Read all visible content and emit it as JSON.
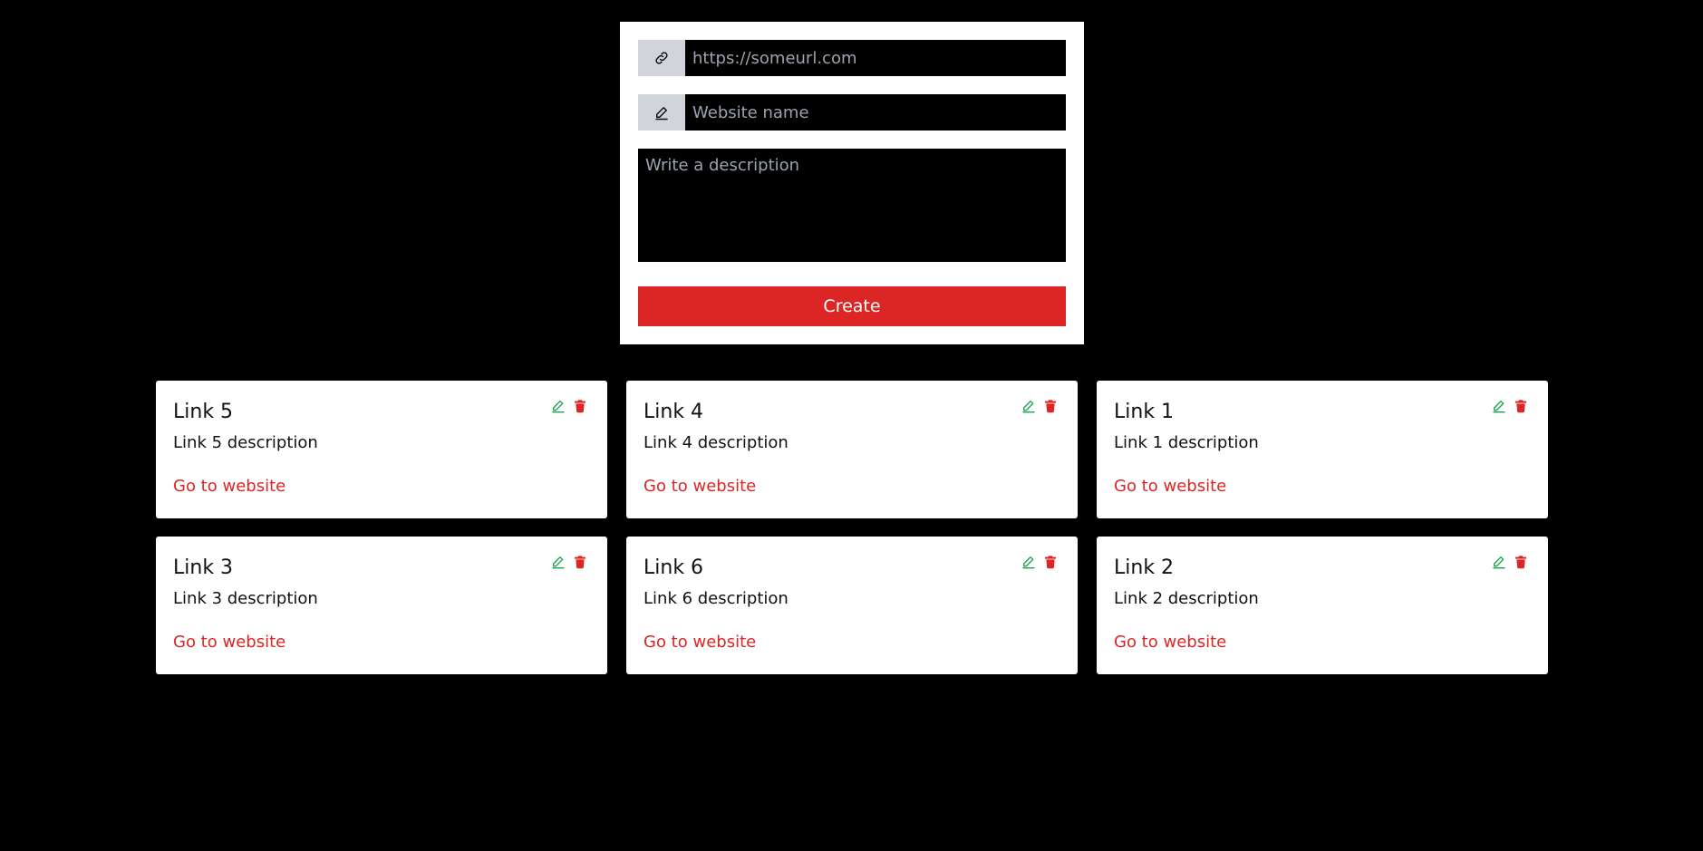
{
  "form": {
    "url_placeholder": "https://someurl.com",
    "name_placeholder": "Website name",
    "description_placeholder": "Write a description",
    "create_label": "Create",
    "url_icon": "link-icon",
    "name_icon": "pencil-icon"
  },
  "links": [
    {
      "title": "Link 5",
      "description": "Link 5 description",
      "go_label": "Go to website"
    },
    {
      "title": "Link 4",
      "description": "Link 4 description",
      "go_label": "Go to website"
    },
    {
      "title": "Link 1",
      "description": "Link 1 description",
      "go_label": "Go to website"
    },
    {
      "title": "Link 3",
      "description": "Link 3 description",
      "go_label": "Go to website"
    },
    {
      "title": "Link 6",
      "description": "Link 6 description",
      "go_label": "Go to website"
    },
    {
      "title": "Link 2",
      "description": "Link 2 description",
      "go_label": "Go to website"
    }
  ],
  "colors": {
    "background": "#000000",
    "accent": "#dc2626",
    "edit": "#16a34a",
    "addon": "#d1d5db"
  }
}
